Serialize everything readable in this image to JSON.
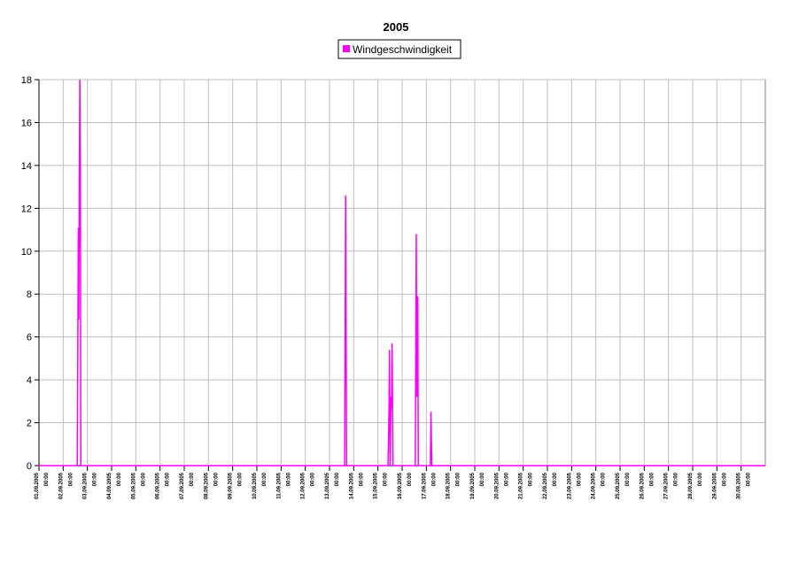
{
  "chart_data": {
    "type": "line",
    "title": "2005",
    "legend": {
      "position": "top-center",
      "entries": [
        "Windgeschwindigkeit"
      ]
    },
    "series": [
      {
        "name": "Windgeschwindigkeit",
        "color": "#ff00ff",
        "points": [
          [
            "01.09.2005 00:00",
            0
          ],
          [
            "02.09.2005 14:00",
            0
          ],
          [
            "02.09.2005 15:00",
            11.1
          ],
          [
            "02.09.2005 15:30",
            6.8
          ],
          [
            "02.09.2005 16:00",
            13.6
          ],
          [
            "02.09.2005 16:30",
            18
          ],
          [
            "02.09.2005 17:00",
            13.8
          ],
          [
            "02.09.2005 17:30",
            0
          ],
          [
            "13.09.2005 15:00",
            0
          ],
          [
            "13.09.2005 16:00",
            12.6
          ],
          [
            "13.09.2005 16:30",
            5.9
          ],
          [
            "13.09.2005 17:00",
            0
          ],
          [
            "15.09.2005 10:00",
            0
          ],
          [
            "15.09.2005 11:00",
            2.7
          ],
          [
            "15.09.2005 11:30",
            5.4
          ],
          [
            "15.09.2005 12:00",
            0
          ],
          [
            "15.09.2005 13:00",
            3.2
          ],
          [
            "15.09.2005 13:30",
            2.7
          ],
          [
            "15.09.2005 14:00",
            5.7
          ],
          [
            "15.09.2005 15:00",
            0
          ],
          [
            "16.09.2005 13:00",
            0
          ],
          [
            "16.09.2005 13:30",
            5.4
          ],
          [
            "16.09.2005 14:00",
            10.8
          ],
          [
            "16.09.2005 14:30",
            3.2
          ],
          [
            "16.09.2005 15:00",
            6.3
          ],
          [
            "16.09.2005 15:30",
            7.9
          ],
          [
            "16.09.2005 16:00",
            0
          ],
          [
            "17.09.2005 04:00",
            0
          ],
          [
            "17.09.2005 04:30",
            2.5
          ],
          [
            "17.09.2005 05:00",
            1.2
          ],
          [
            "17.09.2005 05:30",
            0
          ],
          [
            "01.10.2005 00:00",
            0
          ]
        ]
      }
    ],
    "xlim": [
      "01.09.2005 00:00",
      "01.10.2005 00:00"
    ],
    "x_tick_labels": [
      "01.09.2005",
      "02.09.2005",
      "03.09.2005",
      "04.09.2005",
      "05.09.2005",
      "06.09.2005",
      "07.09.2005",
      "08.09.2005",
      "09.09.2005",
      "10.09.2005",
      "11.09.2005",
      "12.09.2005",
      "13.09.2005",
      "14.09.2005",
      "15.09.2005",
      "16.09.2005",
      "17.09.2005",
      "18.09.2005",
      "19.09.2005",
      "20.09.2005",
      "21.09.2005",
      "22.09.2005",
      "23.09.2005",
      "24.09.2005",
      "25.09.2005",
      "26.09.2005",
      "27.09.2005",
      "28.09.2005",
      "29.09.2005",
      "30.09.2005"
    ],
    "x_tick_time": "00:00",
    "ylim": [
      0,
      18
    ],
    "y_ticks": [
      "0",
      "2",
      "4",
      "6",
      "8",
      "10",
      "12",
      "14",
      "16",
      "18"
    ],
    "grid": true
  }
}
